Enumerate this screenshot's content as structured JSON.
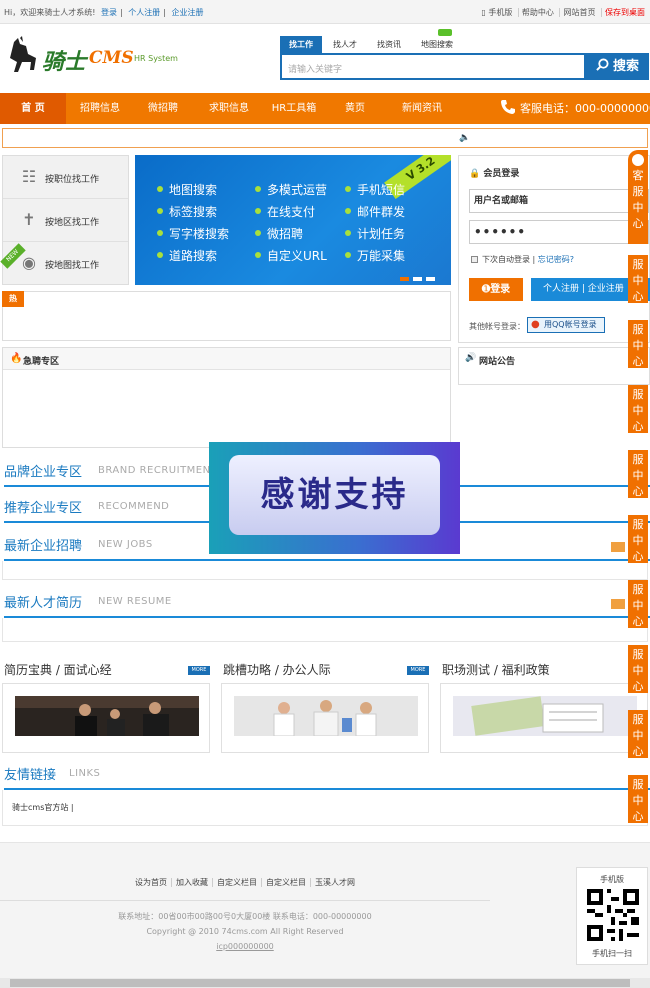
{
  "topbar": {
    "welcome": "Hi，欢迎来骑士人才系统!",
    "login": "登录",
    "personal_register": "个人注册",
    "company_register": "企业注册",
    "right_links": [
      "手机版",
      "帮助中心",
      "网站首页",
      "保存到桌面"
    ]
  },
  "header": {
    "logo_text": "骑士",
    "logo_cms": "CMS",
    "logo_sub": "HR System",
    "search_tabs": [
      "找工作",
      "找人才",
      "找资讯",
      "地图搜索"
    ],
    "search_placeholder": "请输入关键字",
    "search_button": "搜索"
  },
  "nav": {
    "items": [
      "首 页",
      "招聘信息",
      "微招聘",
      "求职信息",
      "HR工具箱",
      "黄页",
      "新闻资讯"
    ],
    "phone": "客服电话：000-00000000"
  },
  "find": {
    "items": [
      "按职位找工作",
      "按地区找工作",
      "按地图找工作"
    ],
    "new_badge": "NEW"
  },
  "banner": {
    "version": "V 3.2",
    "features": [
      "地图搜索",
      "多模式运营",
      "手机短信",
      "标签搜索",
      "在线支付",
      "邮件群发",
      "写字楼搜索",
      "微招聘",
      "计划任务",
      "道路搜索",
      "自定义URL",
      "万能采集"
    ]
  },
  "login": {
    "title": "会员登录",
    "username_value": "用户名或邮箱",
    "password_value": "••••••",
    "auto_login": "下次自动登录",
    "forgot": "忘记密码?",
    "login_button": "登录",
    "register_button": "个人注册 | 企业注册",
    "other_account": "其他帐号登录：",
    "qq_login": "用QQ帐号登录"
  },
  "hot": {
    "tag": "热"
  },
  "urgent": {
    "title": "急聘专区"
  },
  "announce": {
    "title": "网站公告"
  },
  "sections": {
    "brand": {
      "cn": "品牌企业专区",
      "en": "BRAND RECRUITMENT"
    },
    "recommend": {
      "cn": "推荐企业专区",
      "en": "RECOMMEND"
    },
    "new_jobs": {
      "cn": "最新企业招聘",
      "en": "NEW JOBS"
    },
    "new_resume": {
      "cn": "最新人才简历",
      "en": "NEW RESUME"
    },
    "links": {
      "cn": "友情链接",
      "en": "LINKS"
    }
  },
  "thanks": {
    "text": "感谢支持"
  },
  "articles": [
    {
      "title": "简历宝典 / 面试心经",
      "more": "MORE"
    },
    {
      "title": "跳槽功略 / 办公人际",
      "more": "MORE"
    },
    {
      "title": "职场测试 / 福利政策",
      "more": ""
    }
  ],
  "friend_links": {
    "text": "骑士cms官方站 |"
  },
  "side_tabs": [
    "客服中心",
    "服中心",
    "服中心",
    "服中心",
    "服中心",
    "服中心",
    "服中心",
    "服中心",
    "服中心",
    "服中心"
  ],
  "footer": {
    "links": [
      "设为首页",
      "加入收藏",
      "自定义栏目",
      "自定义栏目",
      "玉溪人才网"
    ],
    "address": "联系地址：00省00市00路00号0大厦00楼 联系电话：000-00000000",
    "copyright": "Copyright @ 2010 74cms.com All Right Reserved",
    "icp": "icp000000000",
    "qr_top": "手机版",
    "qr_bottom": "手机扫一扫"
  },
  "colors": {
    "orange": "#f07800",
    "blue": "#1a6fb5",
    "section_blue": "#1a8ad8"
  }
}
